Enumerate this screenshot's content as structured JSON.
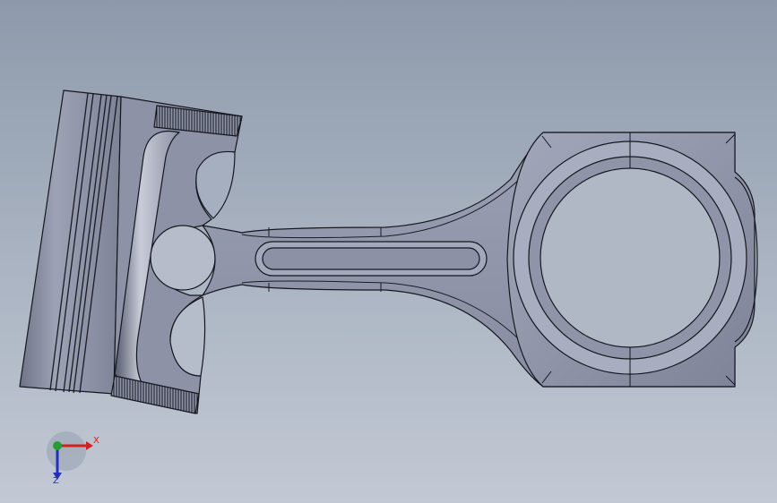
{
  "viewport": {
    "background_top": "#8e9aab",
    "background_bottom": "#c2c9d4"
  },
  "model": {
    "parts": [
      "piston",
      "connecting-rod"
    ],
    "body_color": "#8f94a8",
    "edge_color": "#15171f"
  },
  "triad": {
    "x_label": "X",
    "z_label": "Z",
    "x_color": "#d42020",
    "y_color": "#20a030",
    "z_color": "#2030c0"
  }
}
